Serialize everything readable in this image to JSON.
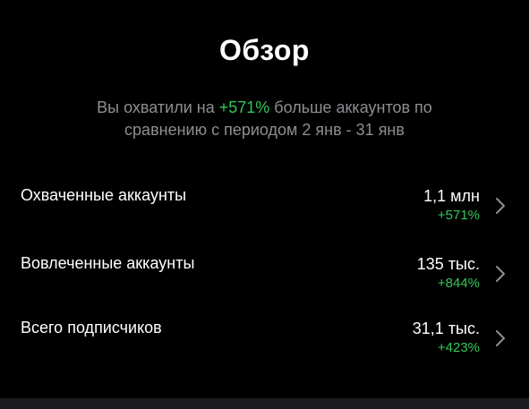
{
  "header": {
    "title": "Обзор"
  },
  "summary": {
    "prefix": "Вы охватили на ",
    "highlight": "+571%",
    "suffix": " больше аккаунтов по сравнению с периодом 2 янв - 31 янв"
  },
  "metrics": [
    {
      "label": "Охваченные аккаунты",
      "value": "1,1 млн",
      "change": "+571%"
    },
    {
      "label": "Вовлеченные аккаунты",
      "value": "135 тыс.",
      "change": "+844%"
    },
    {
      "label": "Всего подписчиков",
      "value": "31,1 тыс.",
      "change": "+423%"
    }
  ],
  "icons": {
    "row_chevron": "chevron-right-icon"
  },
  "colors": {
    "background": "#000000",
    "text_primary": "#ffffff",
    "text_secondary": "#8e8e93",
    "positive": "#34c759",
    "chevron": "#8e8e93"
  }
}
